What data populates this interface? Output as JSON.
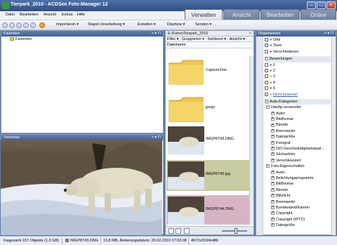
{
  "window": {
    "title": "Tierpark_2010 - ACDSee Foto-Manager 12"
  },
  "menu": [
    "Datei",
    "Bearbeiten",
    "Ansicht",
    "Extras",
    "Hilfe"
  ],
  "modes": [
    "Verwalten",
    "Ansicht",
    "Bearbeiten",
    "Online"
  ],
  "toolbar": {
    "import": "Importieren",
    "batch": "Stapel-Verarbeitung",
    "create": "Erstellen",
    "slideshow": "Diashow",
    "send": "Senden"
  },
  "favorites": {
    "title": "Favoriten",
    "item": "Favoriten"
  },
  "preview": {
    "title": "Vorschau"
  },
  "browser": {
    "path": "E:\\Fotos\\Tierpark_2010",
    "filter": "Filter",
    "group": "Gruppieren",
    "sort": "Sortieren",
    "view": "Ansicht",
    "col": "Dateiname",
    "items": [
      {
        "label": "CaptureOne",
        "type": "folder",
        "bg": "#ffffff"
      },
      {
        "label": "jpegs",
        "type": "folder",
        "bg": "#ffffff"
      },
      {
        "label": "IMGP8743.DNG",
        "type": "photo",
        "bg": "#ffffff"
      },
      {
        "label": "IMGP8743.jpg",
        "type": "photo",
        "bg": "#c9cba0"
      },
      {
        "label": "IMGP8744.DNG",
        "type": "photo",
        "bg": "#d7b4c5"
      }
    ]
  },
  "organizer": {
    "title": "Organisieren",
    "top": [
      "Orte",
      "Tiere",
      "Verschiedenes"
    ],
    "ratingsTitle": "Bewertungen",
    "ratings": [
      {
        "n": "1",
        "c": "#2a5fbf"
      },
      {
        "n": "2",
        "c": "#3aa13a"
      },
      {
        "n": "3",
        "c": "#e0a100"
      },
      {
        "n": "4",
        "c": "#e06a00"
      },
      {
        "n": "5",
        "c": "#c8202a"
      }
    ],
    "unrated": "Nicht bewertet",
    "autoTitle": "Auto-Kategorien",
    "frequent": "Häufig verwendet",
    "frequentItems": [
      "Autor",
      "Bildformat",
      "Blende",
      "Brennweite",
      "Dateigröße",
      "Fotograf",
      "ISO Geschwindigkeitsqual...",
      "Stichwörter",
      "Verschlusszeit"
    ],
    "photoProps": "Foto-Eigenschaften",
    "photoItems": [
      "Autor",
      "Belichtungsprogramm",
      "Bildformat",
      "Blende",
      "Blitzlicht",
      "Brennweite",
      "Bundesland/Kanton",
      "Copyright",
      "Copyright (IPTC)",
      "Dateigröße"
    ]
  },
  "status": {
    "total": "Insgesamt 157 Objekte  (1,3 GB)",
    "file": "IMGP8743.DNG",
    "info": "13,8 MB, Änderungsdatum: 20.02.2010 17:03:08",
    "dims": "4672x3104x48b"
  },
  "colors": {
    "accent": "#3f5f94",
    "title": "#2f4f86"
  }
}
